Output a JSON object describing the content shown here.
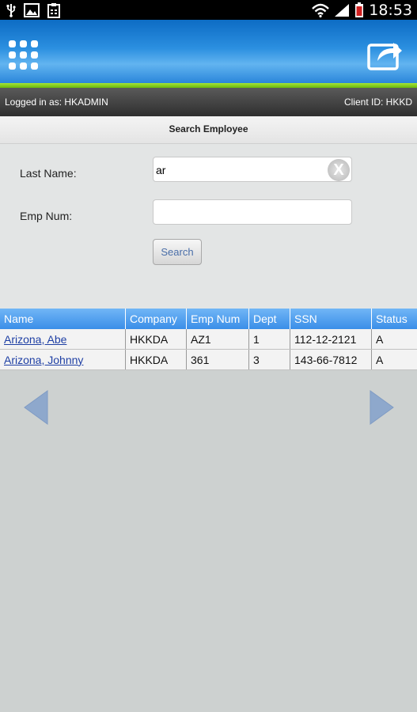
{
  "status_bar": {
    "time": "18:53",
    "icons_left": [
      "usb-icon",
      "image-icon",
      "clipboard-icon"
    ],
    "icons_right": [
      "wifi-icon",
      "signal-icon",
      "battery-icon"
    ]
  },
  "header": {
    "menu_icon": "grid-menu-icon",
    "share_icon": "share-icon",
    "colors": {
      "header_blue": "#2b8fe0",
      "accent_green": "#8fd41f"
    }
  },
  "info_bar": {
    "logged_in": "Logged in as: HKADMIN",
    "client_id": "Client ID: HKKD"
  },
  "page_title": "Search Employee",
  "form": {
    "last_name_label": "Last Name:",
    "last_name_value": "ar",
    "emp_num_label": "Emp Num:",
    "emp_num_value": "",
    "clear_label": "X",
    "search_label": "Search"
  },
  "table": {
    "columns": [
      "Name",
      "Company",
      "Emp Num",
      "Dept",
      "SSN",
      "Status"
    ],
    "rows": [
      {
        "name": "Arizona, Abe",
        "company": "HKKDA",
        "emp_num": "AZ1",
        "dept": "1",
        "ssn": "112-12-2121",
        "status": "A"
      },
      {
        "name": "Arizona, Johnny",
        "company": "HKKDA",
        "emp_num": "361",
        "dept": "3",
        "ssn": "143-66-7812",
        "status": "A"
      }
    ]
  },
  "nav": {
    "prev_icon": "arrow-left-icon",
    "next_icon": "arrow-right-icon"
  }
}
